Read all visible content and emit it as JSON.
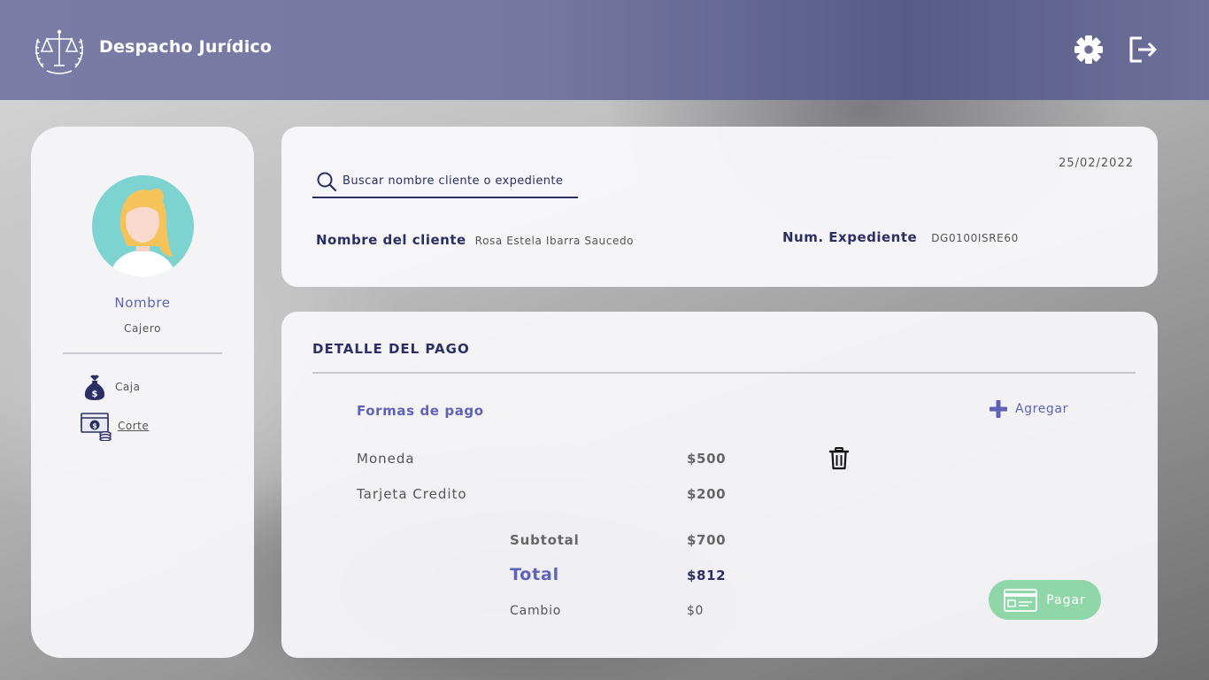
{
  "header": {
    "brand": "Despacho Jurídico",
    "logo_icon": "scales-of-justice-laurel-icon",
    "settings_icon": "gear-icon",
    "logout_icon": "logout-icon"
  },
  "sidebar": {
    "user_name": "Nombre",
    "user_role": "Cajero",
    "items": [
      {
        "label": "Caja",
        "icon": "money-bag-icon"
      },
      {
        "label": "Corte",
        "icon": "cash-stack-icon"
      }
    ]
  },
  "search": {
    "placeholder": "Buscar nombre cliente o expediente",
    "date": "25/02/2022",
    "client_label": "Nombre del cliente",
    "client_value": "Rosa Estela Ibarra Saucedo",
    "expediente_label": "Num. Expediente",
    "expediente_value": "DG0100ISRE60"
  },
  "payment": {
    "title": "DETALLE DEL PAGO",
    "methods_title": "Formas de pago",
    "add_label": "Agregar",
    "methods": [
      {
        "name": "Moneda",
        "amount": "$500"
      },
      {
        "name": "Tarjeta Credito",
        "amount": "$200"
      }
    ],
    "subtotal_label": "Subtotal",
    "subtotal_value": "$700",
    "total_label": "Total",
    "total_value": "$812",
    "cambio_label": "Cambio",
    "cambio_value": "$0",
    "pay_label": "Pagar"
  },
  "colors": {
    "header": "#7577a0",
    "navy": "#2b2f63",
    "accent": "#5f63b8",
    "pay_button": "#8fd7a8"
  }
}
